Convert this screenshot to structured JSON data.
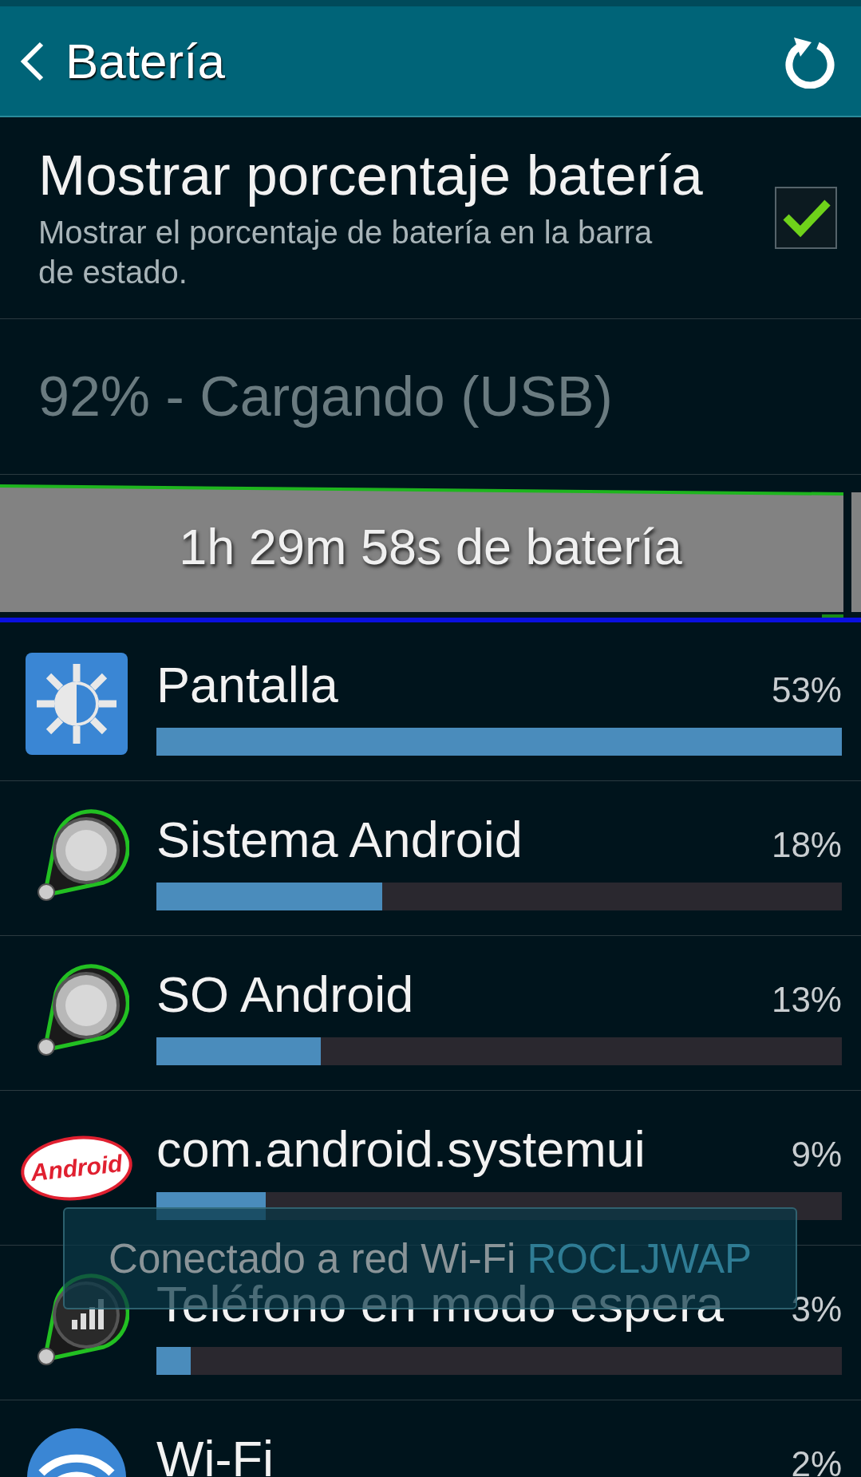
{
  "header": {
    "title": "Batería"
  },
  "setting": {
    "title": "Mostrar porcentaje batería",
    "summary": "Mostrar el porcentaje de batería en la barra de estado.",
    "checked": true
  },
  "status": "92% - Cargando (USB)",
  "graph": {
    "label": "1h 29m 58s de batería"
  },
  "usage": [
    {
      "kind": "display",
      "name": "Pantalla",
      "percent": "53%",
      "level": 1.0
    },
    {
      "kind": "system",
      "name": "Sistema Android",
      "percent": "18%",
      "level": 0.33
    },
    {
      "kind": "system",
      "name": "SO Android",
      "percent": "13%",
      "level": 0.24
    },
    {
      "kind": "android_logo",
      "name": "com.android.systemui",
      "percent": "9%",
      "level": 0.16,
      "icon_text": "Android"
    },
    {
      "kind": "standby",
      "name": "Teléfono en modo espera",
      "percent": "3%",
      "level": 0.05
    },
    {
      "kind": "wifi",
      "name": "Wi-Fi",
      "percent": "2%"
    }
  ],
  "toast": {
    "text": "Conectado a red Wi-Fi",
    "network": "ROCLJWAP"
  }
}
